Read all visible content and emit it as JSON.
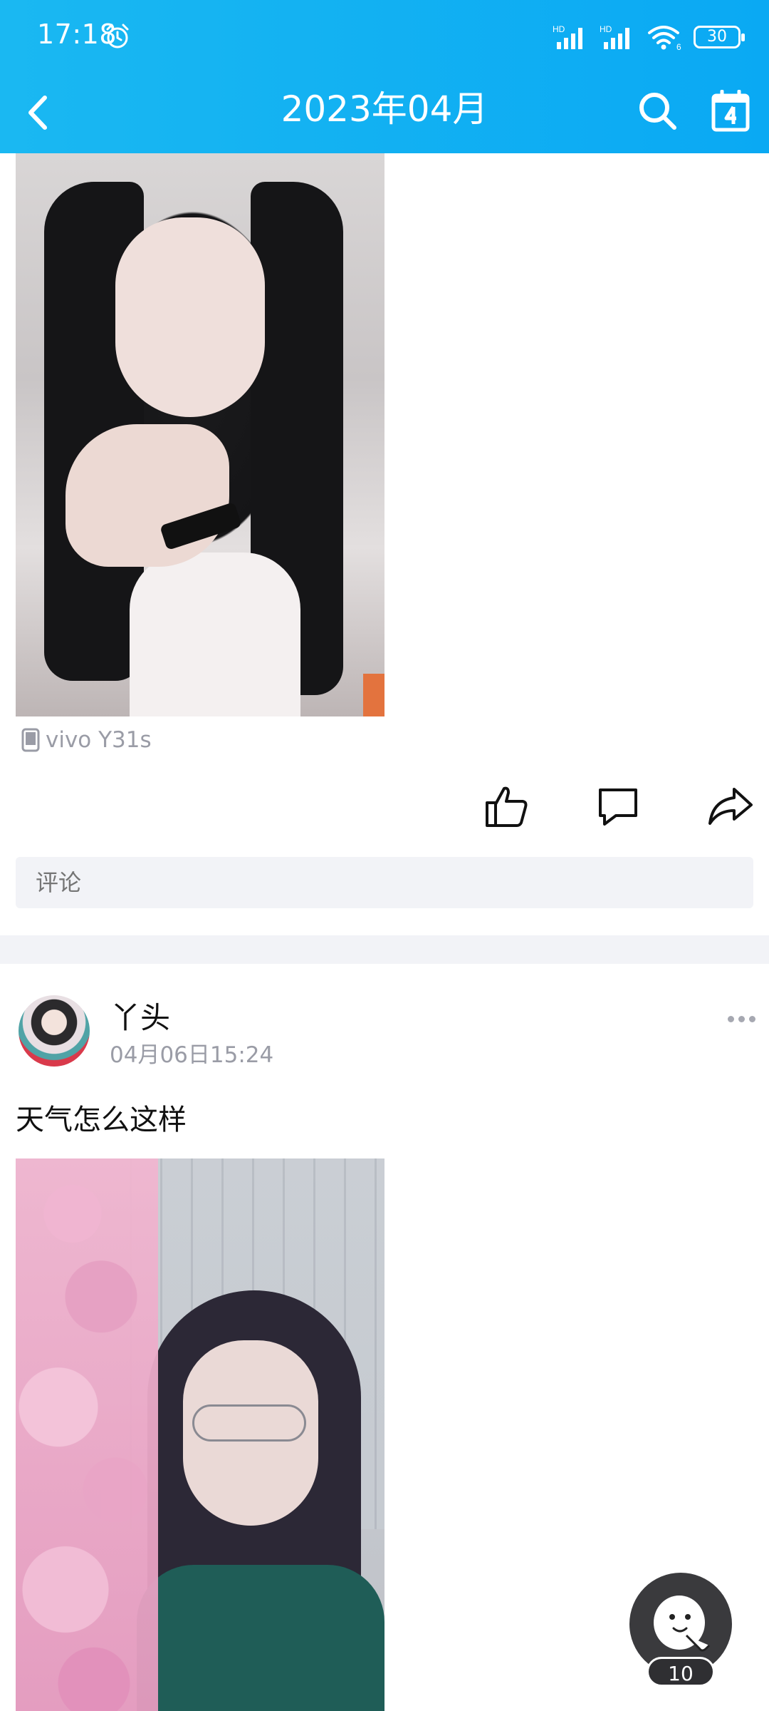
{
  "status_bar": {
    "time": "17:18",
    "battery": "30",
    "network_label_1": "HD",
    "network_label_2": "HD",
    "wifi_label": "6"
  },
  "nav": {
    "title": "2023年04月"
  },
  "post1": {
    "device": "vivo Y31s",
    "comment_placeholder": "评论"
  },
  "post2": {
    "author": "丫头",
    "time": "04月06日15:24",
    "text": "天气怎么这样"
  },
  "fab": {
    "badge": "10"
  },
  "colors": {
    "header": "#0aa9f3",
    "muted_text": "#9a9ca6",
    "input_bg": "#f2f3f7"
  }
}
